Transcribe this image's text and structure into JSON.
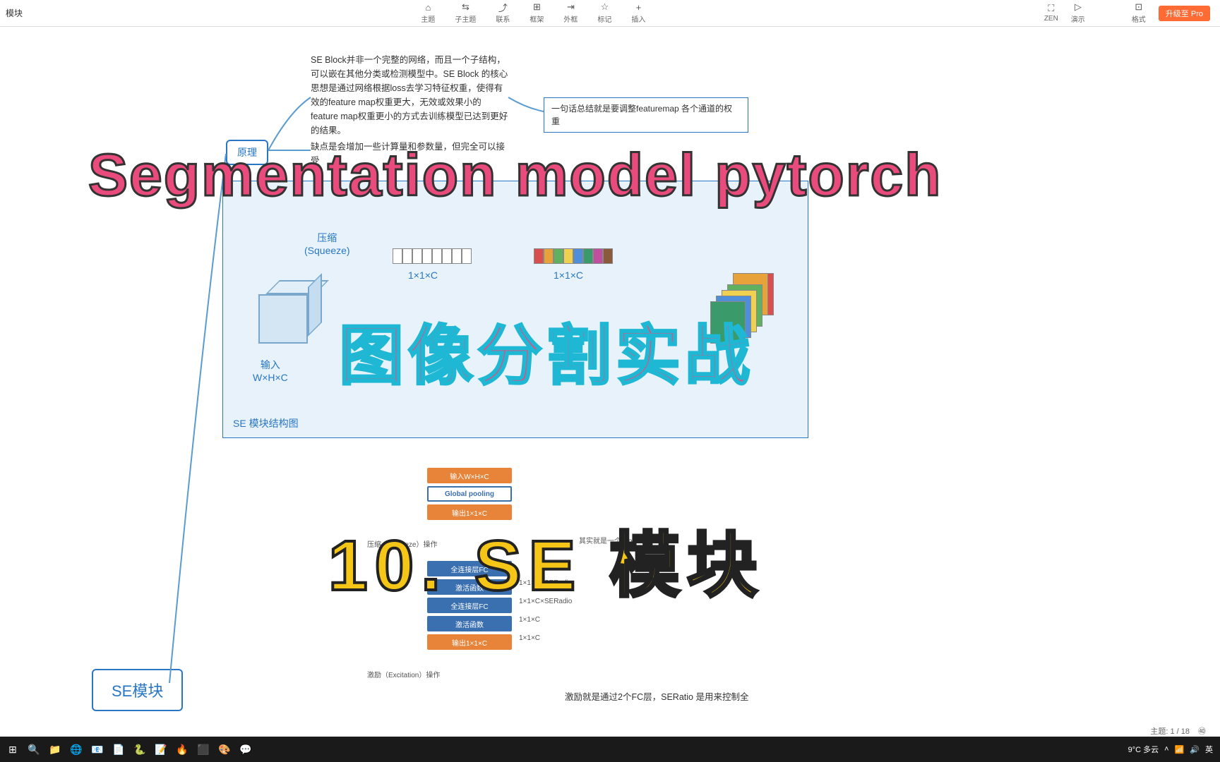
{
  "toolbar": {
    "tab_label": "模块",
    "items": [
      {
        "icon": "⌂",
        "label": "主题"
      },
      {
        "icon": "⇆",
        "label": "子主题"
      },
      {
        "icon": "⤴",
        "label": "联系"
      },
      {
        "icon": "⊞",
        "label": "框架"
      },
      {
        "icon": "⇥",
        "label": "外框"
      },
      {
        "icon": "☆",
        "label": "标记"
      },
      {
        "icon": "+",
        "label": "插入"
      }
    ],
    "right_items": [
      {
        "icon": "⛶",
        "label": "ZEN"
      },
      {
        "icon": "▷",
        "label": "演示"
      }
    ],
    "format_icon": "⊡",
    "format_label": "格式",
    "upgrade": "升级至 Pro"
  },
  "mindmap": {
    "root_label": "SE模块",
    "principle_label": "原理",
    "text1": "SE Block并非一个完整的网络，而且一个子结构，可以嵌在其他分类或检测模型中。SE Block 的核心思想是通过网络根据loss去学习特征权重，使得有效的feature map权重更大，无效或效果小的feature map权重更小的方式去训练模型已达到更好的结果。",
    "text2": "缺点是会增加一些计算量和参数量，但完全可以接受",
    "summary": "一句话总结就是要调整featuremap 各个通道的权重",
    "diagram_title": "SE 模块结构图",
    "squeeze_label": "压缩\n(Squeeze)",
    "input_label": "输入\nW×H×C",
    "dim1": "1×1×C",
    "dim2": "1×1×C",
    "flow": {
      "box1": "输入W×H×C",
      "box2": "Global pooling",
      "box3": "输出1×1×C",
      "squeeze_op": "压缩（Squeeze）操作",
      "global_note": "其实就是一个Global pooling",
      "box4": "全连接层FC",
      "box5": "激活函数",
      "box6": "全连接层FC",
      "box7": "激活函数",
      "box8": "输出1×1×C",
      "excitation_op": "激励（Excitation）操作",
      "dim_a": "1×1×C×SERadio",
      "dim_b": "1×1×C×SERadio",
      "dim_c": "1×1×C",
      "dim_d": "1×1×C"
    },
    "excitation_note": "激励就是通过2个FC层，SERatio 是用来控制全"
  },
  "overlays": {
    "title1": "Segmentation model pytorch",
    "title2": "图像分割实战",
    "title3": "10. SE 模块"
  },
  "status": {
    "topic_count": "主题: 1 / 18",
    "ime": "㊵"
  },
  "taskbar": {
    "weather": "9°C 多云",
    "ime_lang": "英",
    "icons": [
      "⊞",
      "🔍",
      "📁",
      "🌐",
      "📧",
      "📄",
      "🐍",
      "📝",
      "🔥",
      "⬛",
      "🎨",
      "💬"
    ]
  }
}
